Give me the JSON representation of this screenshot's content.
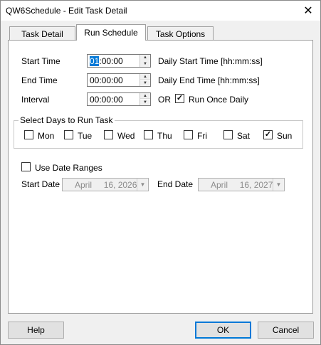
{
  "window": {
    "title": "QW6Schedule - Edit Task Detail",
    "close_glyph": "✕"
  },
  "tabs": [
    {
      "label": "Task Detail"
    },
    {
      "label": "Run Schedule"
    },
    {
      "label": "Task Options"
    }
  ],
  "schedule": {
    "start_time": {
      "label": "Start Time",
      "value_sel": "01",
      "value_rest": ":00:00",
      "hint": "Daily Start Time [hh:mm:ss]"
    },
    "end_time": {
      "label": "End Time",
      "value": "00:00:00",
      "hint": "Daily End Time [hh:mm:ss]"
    },
    "interval": {
      "label": "Interval",
      "value": "00:00:00",
      "or_label": "OR"
    },
    "run_once": {
      "label": "Run Once Daily",
      "checked": true
    }
  },
  "days": {
    "legend": "Select Days to Run Task",
    "items": [
      {
        "label": "Mon",
        "checked": false
      },
      {
        "label": "Tue",
        "checked": false
      },
      {
        "label": "Wed",
        "checked": false
      },
      {
        "label": "Thu",
        "checked": false
      },
      {
        "label": "Fri",
        "checked": false
      },
      {
        "label": "Sat",
        "checked": false
      },
      {
        "label": "Sun",
        "checked": true
      }
    ]
  },
  "date_ranges": {
    "use_label": "Use Date Ranges",
    "use_checked": false,
    "start_label": "Start Date",
    "start_month": "April",
    "start_day": "16, 2026",
    "end_label": "End Date",
    "end_month": "April",
    "end_day": "16, 2027"
  },
  "buttons": {
    "help": "Help",
    "ok": "OK",
    "cancel": "Cancel"
  },
  "check_glyph": "✓",
  "spin_up": "▲",
  "spin_down": "▼",
  "dropdown_glyph": "▼"
}
